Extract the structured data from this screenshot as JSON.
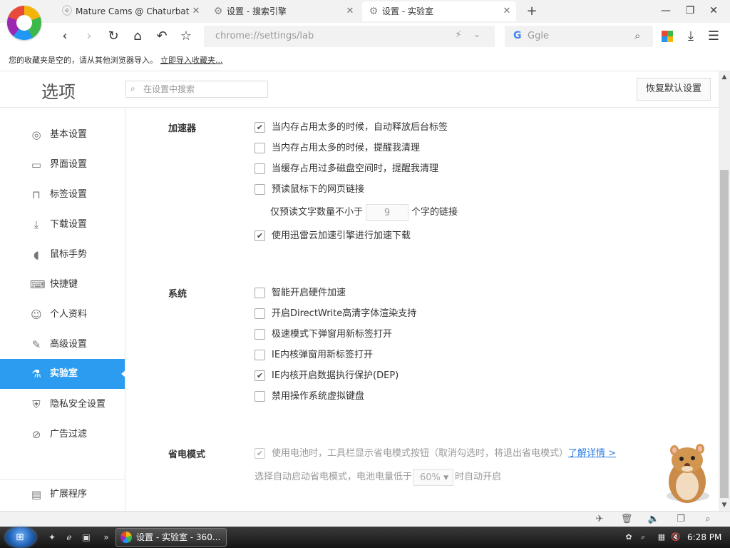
{
  "browser": {
    "tabs": [
      {
        "title": "Mature Cams @ Chaturbat",
        "icon": "chaturbate-icon"
      },
      {
        "title": "设置 - 搜索引擎",
        "icon": "gear-icon"
      },
      {
        "title": "设置 - 实验室",
        "icon": "gear-icon",
        "active": true
      }
    ],
    "new_tab": "+",
    "address": "chrome://settings/lab",
    "search_placeholder": "Ggle",
    "bookmarks_empty_text": "您的收藏夹是空的，请从其他浏览器导入。",
    "bookmarks_import_link": "立即导入收藏夹..."
  },
  "settings": {
    "title": "选项",
    "search_placeholder": "在设置中搜索",
    "restore_button": "恢复默认设置"
  },
  "sidebar": {
    "items": [
      {
        "label": "基本设置",
        "icon": "gear-circle-icon"
      },
      {
        "label": "界面设置",
        "icon": "window-icon"
      },
      {
        "label": "标签设置",
        "icon": "tab-icon"
      },
      {
        "label": "下载设置",
        "icon": "download-icon"
      },
      {
        "label": "鼠标手势",
        "icon": "mouse-icon"
      },
      {
        "label": "快捷键",
        "icon": "keyboard-icon"
      },
      {
        "label": "个人资料",
        "icon": "user-icon"
      },
      {
        "label": "高级设置",
        "icon": "wrench-icon"
      },
      {
        "label": "实验室",
        "icon": "flask-icon",
        "active": true
      },
      {
        "label": "隐私安全设置",
        "icon": "shield-icon"
      },
      {
        "label": "广告过滤",
        "icon": "block-icon"
      }
    ],
    "extensions": {
      "label": "扩展程序",
      "icon": "extensions-icon"
    }
  },
  "sections": {
    "accelerator": {
      "title": "加速器",
      "options": [
        {
          "label": "当内存占用太多的时候，自动释放后台标签",
          "checked": true
        },
        {
          "label": "当内存占用太多的时候，提醒我清理",
          "checked": false
        },
        {
          "label": "当缓存占用过多磁盘空间时，提醒我清理",
          "checked": false
        },
        {
          "label": "预读鼠标下的网页链接",
          "checked": false
        }
      ],
      "preread_prefix": "仅预读文字数量不小于",
      "preread_value": "9",
      "preread_suffix": "个字的链接",
      "thunder_option": {
        "label": "使用迅雷云加速引擎进行加速下载",
        "checked": true
      }
    },
    "system": {
      "title": "系统",
      "options": [
        {
          "label": "智能开启硬件加速",
          "checked": false
        },
        {
          "label": "开启DirectWrite高清字体渲染支持",
          "checked": false
        },
        {
          "label": "极速模式下弹窗用新标签打开",
          "checked": false
        },
        {
          "label": "IE内核弹窗用新标签打开",
          "checked": false
        },
        {
          "label": "IE内核开启数据执行保护(DEP)",
          "checked": true
        },
        {
          "label": "禁用操作系统虚拟键盘",
          "checked": false
        }
      ]
    },
    "power": {
      "title": "省电模式",
      "option": {
        "label": "使用电池时，工具栏显示省电模式按钮（取消勾选时，将退出省电模式）",
        "checked": true
      },
      "details_link": "了解详情 >",
      "auto_prefix": "选择自动启动省电模式，电池电量低于",
      "auto_value": "60%",
      "auto_suffix": "时自动开启"
    }
  },
  "taskbar": {
    "task_title": "设置 - 实验室 - 360...",
    "clock": "6:28 PM",
    "more": "»"
  },
  "colors": {
    "accent": "#2b9cf0",
    "link": "#2b7de9"
  }
}
